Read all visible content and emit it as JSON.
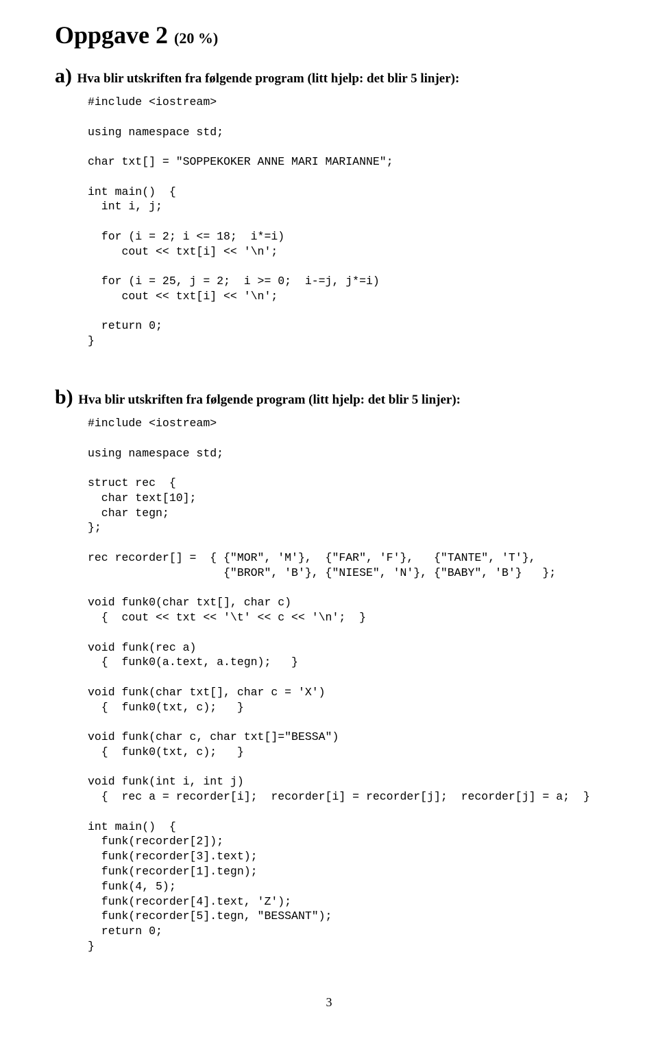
{
  "title": {
    "main": "Oppgave 2 ",
    "paren": "(20 %)"
  },
  "part_a": {
    "letter": "a) ",
    "prompt": "Hva blir utskriften fra følgende program (litt hjelp: det blir 5 linjer):",
    "code": "#include <iostream>\n\nusing namespace std;\n\nchar txt[] = \"SOPPEKOKER ANNE MARI MARIANNE\";\n\nint main()  {\n  int i, j;\n\n  for (i = 2; i <= 18;  i*=i)\n     cout << txt[i] << '\\n';\n\n  for (i = 25, j = 2;  i >= 0;  i-=j, j*=i)\n     cout << txt[i] << '\\n';\n\n  return 0;\n}"
  },
  "part_b": {
    "letter": "b) ",
    "prompt": "Hva blir utskriften fra følgende program (litt hjelp: det blir 5 linjer):",
    "code": "#include <iostream>\n\nusing namespace std;\n\nstruct rec  {\n  char text[10];\n  char tegn;\n};\n\nrec recorder[] =  { {\"MOR\", 'M'},  {\"FAR\", 'F'},   {\"TANTE\", 'T'},\n                    {\"BROR\", 'B'}, {\"NIESE\", 'N'}, {\"BABY\", 'B'}   };\n\nvoid funk0(char txt[], char c)\n  {  cout << txt << '\\t' << c << '\\n';  }\n\nvoid funk(rec a)\n  {  funk0(a.text, a.tegn);   }\n\nvoid funk(char txt[], char c = 'X')\n  {  funk0(txt, c);   }\n\nvoid funk(char c, char txt[]=\"BESSA\")\n  {  funk0(txt, c);   }\n\nvoid funk(int i, int j)\n  {  rec a = recorder[i];  recorder[i] = recorder[j];  recorder[j] = a;  }\n\nint main()  {\n  funk(recorder[2]);\n  funk(recorder[3].text);\n  funk(recorder[1].tegn);\n  funk(4, 5);\n  funk(recorder[4].text, 'Z');\n  funk(recorder[5].tegn, \"BESSANT\");\n  return 0;\n}"
  },
  "page_number": "3"
}
